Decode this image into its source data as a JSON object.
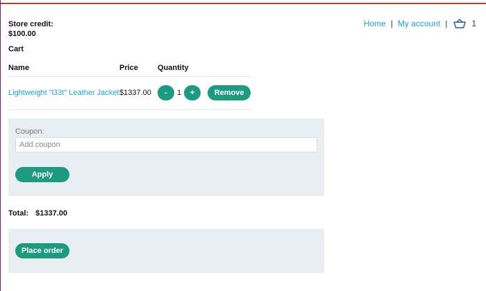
{
  "store_credit": {
    "label": "Store credit:",
    "amount": "$100.00"
  },
  "nav": {
    "home": "Home",
    "separator": "|",
    "my_account": "My account",
    "cart_count": "1"
  },
  "cart": {
    "title": "Cart",
    "columns": [
      "Name",
      "Price",
      "Quantity"
    ],
    "items": [
      {
        "name": "Lightweight \"l33t\" Leather Jacket",
        "price": "$1337.00",
        "quantity": "1",
        "decrement_label": "-",
        "increment_label": "+",
        "remove_label": "Remove"
      }
    ]
  },
  "coupon": {
    "label": "Coupon:",
    "placeholder": "Add coupon",
    "apply_label": "Apply"
  },
  "total": {
    "label": "Total:",
    "value": "$1337.00"
  },
  "order": {
    "place_order_label": "Place order"
  },
  "colors": {
    "accent": "#1d9a7f",
    "link": "#1f9fd6",
    "panel": "#e8eef1"
  }
}
